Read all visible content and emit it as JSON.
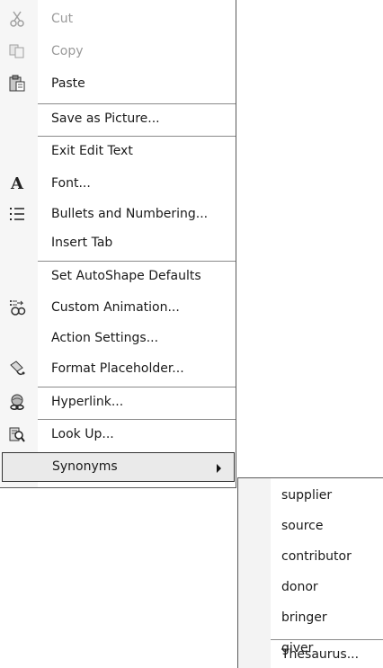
{
  "context_menu": {
    "items": [
      {
        "label": "Cut",
        "icon": "scissors-icon",
        "enabled": false
      },
      {
        "label": "Copy",
        "icon": "copy-icon",
        "enabled": false
      },
      {
        "label": "Paste",
        "icon": "paste-icon",
        "enabled": true
      },
      {
        "label": "Save as Picture...",
        "icon": null,
        "enabled": true
      },
      {
        "label": "Exit Edit Text",
        "icon": null,
        "enabled": true
      },
      {
        "label": "Font...",
        "icon": "font-icon",
        "enabled": true
      },
      {
        "label": "Bullets and Numbering...",
        "icon": "bullets-icon",
        "enabled": true
      },
      {
        "label": "Insert Tab",
        "icon": null,
        "enabled": true
      },
      {
        "label": "Set AutoShape Defaults",
        "icon": null,
        "enabled": true
      },
      {
        "label": "Custom Animation...",
        "icon": "custom-animation-icon",
        "enabled": true
      },
      {
        "label": "Action Settings...",
        "icon": null,
        "enabled": true
      },
      {
        "label": "Format Placeholder...",
        "icon": "format-placeholder-icon",
        "enabled": true
      },
      {
        "label": "Hyperlink...",
        "icon": "hyperlink-icon",
        "enabled": true
      },
      {
        "label": "Look Up...",
        "icon": "look-up-icon",
        "enabled": true
      },
      {
        "label": "Synonyms",
        "icon": null,
        "enabled": true,
        "selected": true,
        "has_submenu": true
      }
    ]
  },
  "synonyms_submenu": {
    "items": [
      {
        "label": "supplier"
      },
      {
        "label": "source"
      },
      {
        "label": "contributor"
      },
      {
        "label": "donor"
      },
      {
        "label": "bringer"
      },
      {
        "label": "giver"
      },
      {
        "label": "Thesaurus..."
      }
    ]
  }
}
